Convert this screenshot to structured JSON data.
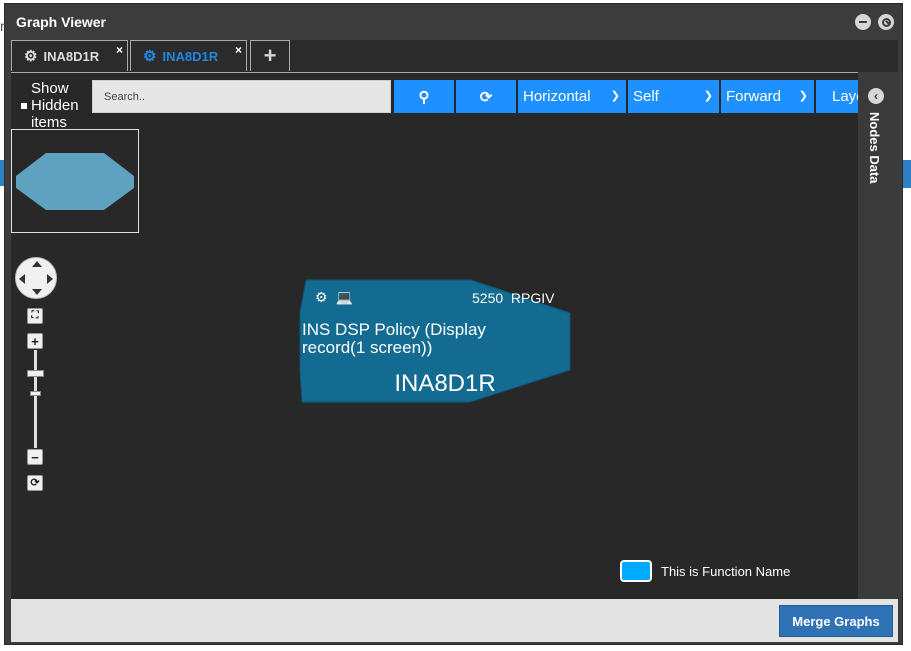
{
  "window": {
    "title": "Graph Viewer"
  },
  "tabs": [
    {
      "label": "INA8D1R",
      "close": "×",
      "active": false
    },
    {
      "label": "INA8D1R",
      "close": "×",
      "active": true
    }
  ],
  "tab_add": "+",
  "toolbar": {
    "show_hidden_label": "Show Hidden items",
    "search_placeholder": "Search..",
    "search_icon": "🔍",
    "refresh_icon": "⟳",
    "direction": "Horizontal",
    "scope": "Self",
    "flow": "Forward",
    "layout": "Layout"
  },
  "side_panel": {
    "label": "Nodes Data",
    "chevron": "‹"
  },
  "node": {
    "code": "5250  RPGIV",
    "description": "INS DSP Policy (Display record(1 screen))",
    "name": "INA8D1R",
    "icons": [
      "gear-icon",
      "monitor-icon"
    ]
  },
  "legend": {
    "label": "This is Function Name",
    "color": "#00aaff"
  },
  "zoom": {
    "plus": "+",
    "minus": "−",
    "fit": "⛶",
    "reset": "⟳"
  },
  "footer": {
    "merge_label": "Merge Graphs"
  },
  "colors": {
    "accent": "#1e90ff",
    "node_fill": "#136b92",
    "minimap_node": "#5fa2c0"
  }
}
